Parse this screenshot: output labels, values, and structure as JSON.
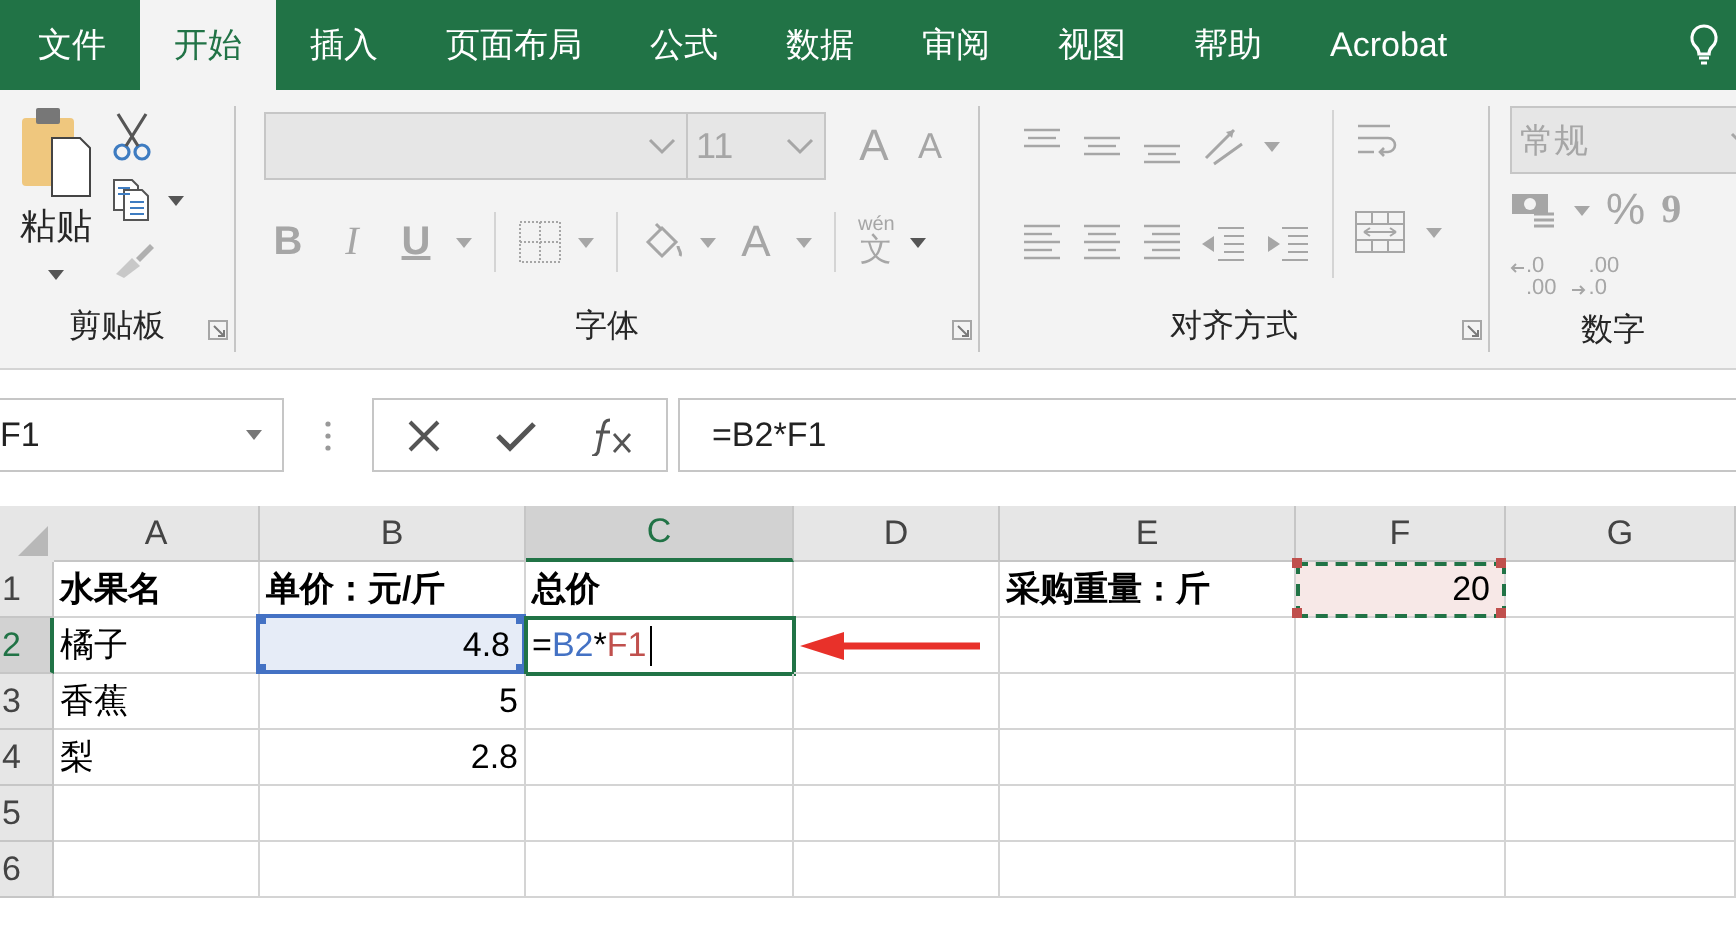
{
  "tabs": [
    {
      "label": "文件",
      "selected": false
    },
    {
      "label": "开始",
      "selected": true
    },
    {
      "label": "插入",
      "selected": false
    },
    {
      "label": "页面布局",
      "selected": false
    },
    {
      "label": "公式",
      "selected": false
    },
    {
      "label": "数据",
      "selected": false
    },
    {
      "label": "审阅",
      "selected": false
    },
    {
      "label": "视图",
      "selected": false
    },
    {
      "label": "帮助",
      "selected": false
    },
    {
      "label": "Acrobat",
      "selected": false
    }
  ],
  "ribbon": {
    "clipboard": {
      "paste_label": "粘贴",
      "group_label": "剪贴板"
    },
    "font": {
      "disabled": true,
      "font_size": "11",
      "grow": "A",
      "shrink": "A",
      "bold": "B",
      "italic": "I",
      "underline": "U",
      "font_color": "A",
      "phonetic_top": "wén",
      "phonetic_char": "文",
      "group_label": "字体"
    },
    "alignment": {
      "disabled": true,
      "group_label": "对齐方式"
    },
    "number": {
      "disabled": true,
      "format": "常规",
      "percent": "%",
      "comma": "9",
      "increase_top": ".0",
      "increase_bottom": ".00",
      "decrease_top": ".00",
      "decrease_bottom": ".0",
      "group_label": "数字"
    }
  },
  "formula_bar": {
    "name_box": "F1",
    "formula": "=B2*F1"
  },
  "columns": [
    {
      "label": "A",
      "selected": false
    },
    {
      "label": "B",
      "selected": false
    },
    {
      "label": "C",
      "selected": true
    },
    {
      "label": "D",
      "selected": false
    },
    {
      "label": "E",
      "selected": false
    },
    {
      "label": "F",
      "selected": false
    },
    {
      "label": "G",
      "selected": false
    }
  ],
  "rows": [
    {
      "label": "1",
      "selected": false,
      "cells": [
        {
          "text": "水果名",
          "bold": true
        },
        {
          "text": "单价：元/斤",
          "bold": true
        },
        {
          "text": "总价",
          "bold": true
        },
        {},
        {
          "text": "采购重量：斤",
          "bold": true
        },
        {
          "text": "20",
          "kind": "number",
          "color": "#c0504d",
          "marquee": true
        },
        {}
      ]
    },
    {
      "label": "2",
      "selected": true,
      "cells": [
        {
          "text": "橘子"
        },
        {
          "text": "4.8",
          "kind": "number",
          "color": "#4472c4"
        },
        {
          "kind": "editing",
          "active": true,
          "parts": [
            {
              "text": "="
            },
            {
              "text": "B2",
              "color": "#4472c4"
            },
            {
              "text": "*"
            },
            {
              "text": "F1",
              "color": "#c0504d"
            }
          ]
        },
        {},
        {},
        {},
        {}
      ]
    },
    {
      "label": "3",
      "selected": false,
      "cells": [
        {
          "text": "香蕉"
        },
        {
          "text": "5",
          "kind": "number"
        },
        {},
        {},
        {},
        {},
        {}
      ]
    },
    {
      "label": "4",
      "selected": false,
      "cells": [
        {
          "text": "梨"
        },
        {
          "text": "2.8",
          "kind": "number"
        },
        {},
        {},
        {},
        {},
        {}
      ]
    },
    {
      "label": "5",
      "selected": false,
      "cells": [
        {},
        {},
        {},
        {},
        {},
        {},
        {}
      ]
    },
    {
      "label": "6",
      "selected": false,
      "cells": [
        {},
        {},
        {},
        {},
        {},
        {},
        {}
      ]
    }
  ]
}
